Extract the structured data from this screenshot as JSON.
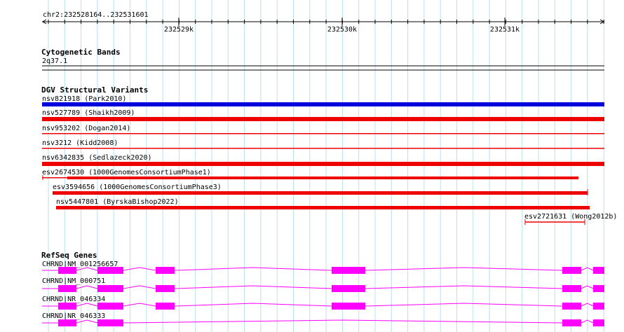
{
  "ruler": {
    "location": "chr2:232528164..232531601",
    "ticks": [
      "232529k",
      "232530k",
      "232531k"
    ]
  },
  "tracks": {
    "cytobands": {
      "title": "Cytogenetic Bands",
      "band_label": "2q37.1"
    },
    "dgv": {
      "title": "DGV Structural Variants",
      "variants": [
        {
          "label": "nsv821918 (Park2010)",
          "color": "#0000dd"
        },
        {
          "label": "nsv527789 (Shaikh2009)",
          "color": "#ee0000"
        },
        {
          "label": "nsv953202 (Dogan2014)",
          "color": "#ee0000"
        },
        {
          "label": "nsv3212 (Kidd2008)",
          "color": "#ee0000"
        },
        {
          "label": "nsv6342835 (Sedlazeck2020)",
          "color": "#ee0000"
        },
        {
          "label": "esv2674530 (1000GenomesConsortiumPhase1)",
          "color": "#ee0000"
        },
        {
          "label": "esv3594656 (1000GenomesConsortiumPhase3)",
          "color": "#ee0000"
        },
        {
          "label": "nsv5447801 (ByrskaBishop2022)",
          "color": "#ee0000"
        },
        {
          "label": "esv2721631 (Wong2012b)",
          "color": "#ee0000"
        }
      ]
    },
    "refseq": {
      "title": "RefSeq Genes",
      "color": "#ff00ff",
      "transcripts": [
        {
          "label": "CHRND|NM_001256657"
        },
        {
          "label": "CHRND|NM_000751"
        },
        {
          "label": "CHRND|NR_046334"
        },
        {
          "label": "CHRND|NR_046333"
        }
      ]
    }
  }
}
